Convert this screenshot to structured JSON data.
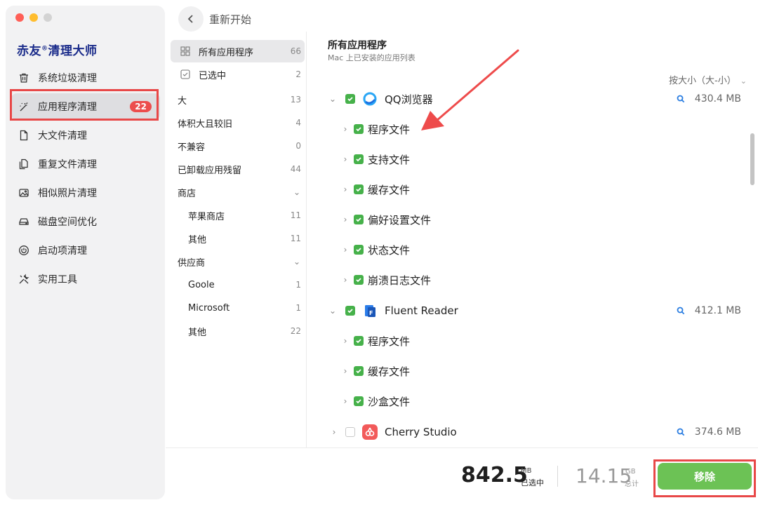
{
  "colors": {
    "accent": "#46b14a",
    "badge": "#ec4d4d",
    "highlight": "#e84848",
    "remove": "#6cc255",
    "brand": "#1a2b8a"
  },
  "app": {
    "brand": "赤友",
    "brand_mark": "®",
    "brand_suffix": "清理大师"
  },
  "sidebar": {
    "items": [
      {
        "label": "系统垃圾清理",
        "icon": "trash-icon"
      },
      {
        "label": "应用程序清理",
        "icon": "magic-wand-icon",
        "badge": "22",
        "active": true
      },
      {
        "label": "大文件清理",
        "icon": "file-icon"
      },
      {
        "label": "重复文件清理",
        "icon": "duplicate-file-icon"
      },
      {
        "label": "相似照片清理",
        "icon": "photo-icon"
      },
      {
        "label": "磁盘空间优化",
        "icon": "disk-icon"
      },
      {
        "label": "启动项清理",
        "icon": "power-icon"
      },
      {
        "label": "实用工具",
        "icon": "tools-icon"
      }
    ]
  },
  "header": {
    "back_label": "重新开始"
  },
  "filters": [
    {
      "label": "所有应用程序",
      "count": "66",
      "icon": "grid-icon",
      "selected": true
    },
    {
      "label": "已选中",
      "count": "2",
      "icon": "checkbox-icon"
    },
    {
      "label": "大",
      "count": "13"
    },
    {
      "label": "体积大且较旧",
      "count": "4"
    },
    {
      "label": "不兼容",
      "count": "0"
    },
    {
      "label": "已卸载应用残留",
      "count": "44"
    },
    {
      "label": "商店",
      "expandable": true
    },
    {
      "label": "苹果商店",
      "count": "11",
      "sub": true
    },
    {
      "label": "其他",
      "count": "11",
      "sub": true
    },
    {
      "label": "供应商",
      "expandable": true
    },
    {
      "label": "Goole",
      "count": "1",
      "sub": true
    },
    {
      "label": "Microsoft",
      "count": "1",
      "sub": true
    },
    {
      "label": "其他",
      "count": "22",
      "sub": true
    }
  ],
  "list": {
    "title": "所有应用程序",
    "subtitle": "Mac 上已安装的应用列表",
    "sort_label": "按大小（大-小）",
    "apps": [
      {
        "name": "QQ浏览器",
        "size": "430.4 MB",
        "checked": true,
        "expanded": true,
        "icon": "qq-browser-icon",
        "children": [
          "程序文件",
          "支持文件",
          "缓存文件",
          "偏好设置文件",
          "状态文件",
          "崩溃日志文件"
        ]
      },
      {
        "name": "Fluent Reader",
        "size": "412.1 MB",
        "checked": true,
        "expanded": true,
        "icon": "fluent-reader-icon",
        "children": [
          "程序文件",
          "缓存文件",
          "沙盒文件"
        ]
      },
      {
        "name": "Cherry Studio",
        "size": "374.6 MB",
        "checked": false,
        "expanded": false,
        "icon": "cherry-studio-icon",
        "children": []
      }
    ]
  },
  "footer": {
    "selected_value": "842.5",
    "selected_unit": "MB",
    "selected_label": "已选中",
    "total_value": "14.15",
    "total_unit": "GB",
    "total_label": "总计",
    "remove_label": "移除"
  }
}
